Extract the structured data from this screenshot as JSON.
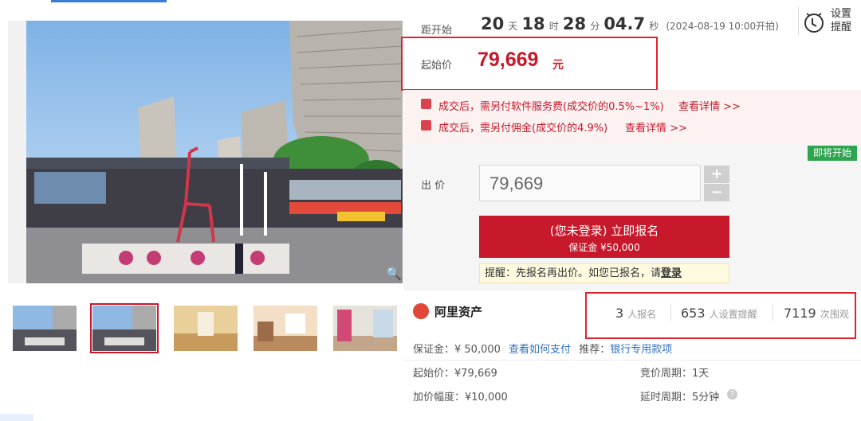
{
  "countdown": {
    "label": "距开始",
    "days": "20",
    "days_unit": "天",
    "hours": "18",
    "hours_unit": "时",
    "minutes": "28",
    "minutes_unit": "分",
    "seconds": "04.7",
    "seconds_unit": "秒",
    "start_note": "(2024-08-19 10:00开拍)"
  },
  "reminder": {
    "line1": "设置",
    "line2": "提醒"
  },
  "start_price": {
    "label": "起始价",
    "value": "79,669",
    "unit": "元"
  },
  "notices": [
    {
      "text": "成交后，需另付软件服务费(成交价的0.5%~1%)",
      "link": "查看详情 >>"
    },
    {
      "text": "成交后，需另付佣金(成交价的4.9%)",
      "link": "查看详情 >>"
    }
  ],
  "status_badge": "即将开始",
  "bid": {
    "label": "出 价",
    "value": "79,669",
    "plus": "+",
    "minus": "−",
    "apply_line1": "(您未登录) 立即报名",
    "apply_line2": "保证金 ¥50,000",
    "tip_prefix": "提醒：先报名再出价。如您已报名，请",
    "tip_link": "登录"
  },
  "platform": {
    "name": "阿里资产"
  },
  "stats": [
    {
      "num": "3",
      "label": "人报名"
    },
    {
      "num": "653",
      "label": "人设置提醒"
    },
    {
      "num": "7119",
      "label": "次围观"
    }
  ],
  "details": {
    "deposit": "保证金：¥ 50,000",
    "how_to_pay": "查看如何支付",
    "recommend_label": "推荐：",
    "recommend_value": "银行专用款项",
    "start_price": "起始价：¥79,669",
    "bid_cycle": "竞价周期：1天",
    "increment": "加价幅度：¥10,000",
    "extension": "延时周期：5分钟"
  },
  "colors": {
    "accent_red": "#c7192b",
    "badge_green": "#2ea44f",
    "link_blue": "#3070c4"
  },
  "icons": [
    "clock-icon",
    "zoom-icon",
    "fee-icon",
    "help-icon",
    "ali-logo-icon"
  ]
}
